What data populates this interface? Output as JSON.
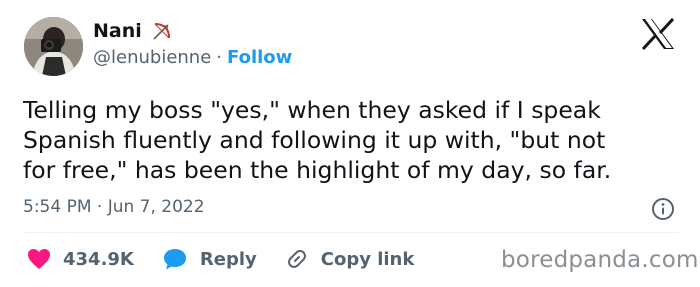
{
  "tweet": {
    "author_name": "Nani",
    "handle": "@lenubienne",
    "separator": "·",
    "follow_label": "Follow",
    "text": "Telling my boss \"yes,\" when they asked if I speak\nSpanish fluently and following it up with, \"but not\nfor free,\" has been the highlight of my day, so far.",
    "timestamp": "5:54 PM · Jun 7, 2022",
    "likes": "434.9K",
    "reply_label": "Reply",
    "copy_link_label": "Copy link"
  },
  "icons": {
    "name_emoji": "bow-and-arrow-icon",
    "platform": "x-logo-icon",
    "info": "info-icon",
    "like": "heart-icon",
    "reply": "speech-bubble-icon",
    "copy": "link-icon"
  },
  "colors": {
    "accent": "#1d9bf0",
    "like": "#f91880",
    "muted": "#536471",
    "text": "#0f1419"
  },
  "watermark": "boredpanda.com"
}
